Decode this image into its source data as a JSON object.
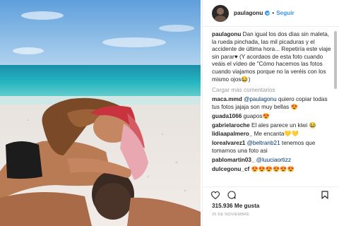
{
  "post": {
    "username": "paulagonu",
    "follow_label": "Seguir",
    "separator": "•",
    "caption_user": "paulagonu",
    "caption_text": "Dan igual los dos días sin maleta, la rueda pinchada, las mil picaduras y el accidente de última hora... Repetiría este viaje sin parar♥ (Y acordaos de esta foto cuando veáis el vídeo de \"Cómo hacemos las fotos cuando viajamos porque no la veréis con los mismo ojos😂)",
    "load_more": "Cargar más comentarios",
    "likes": "315.936 Me gusta",
    "date": "25 DE NOVIEMBRE"
  },
  "comments": [
    {
      "user": "maca.mmd",
      "mention": "@paulagonu",
      "text": "quiero copiar todas tus fotos jajaja son muy bellas 😍"
    },
    {
      "user": "guada1066",
      "mention": "",
      "text": "guapos😍"
    },
    {
      "user": "gabrielaroche",
      "mention": "",
      "text": "El ales parece un kiwi 😂"
    },
    {
      "user": "lidiaapalmero_",
      "mention": "",
      "text": "Me encanta💛💛"
    },
    {
      "user": "lorealvarez1",
      "mention": "@beltranb21",
      "text": "tenemos que tomarnos una foto asi"
    },
    {
      "user": "pablomartin03_",
      "mention": "@luuciaortizz",
      "text": ""
    },
    {
      "user": "dulcegonu_cf",
      "mention": "",
      "text": "😍😍😍😍😍😍"
    }
  ],
  "icons": {
    "verified": "verified-badge-icon",
    "like": "heart-icon",
    "comment": "comment-icon",
    "save": "bookmark-icon"
  },
  "colors": {
    "accent": "#3897f0",
    "mention": "#003569",
    "muted": "#999999",
    "text": "#262626",
    "sea": "#1fb2bf",
    "sand": "#efe8e3"
  }
}
